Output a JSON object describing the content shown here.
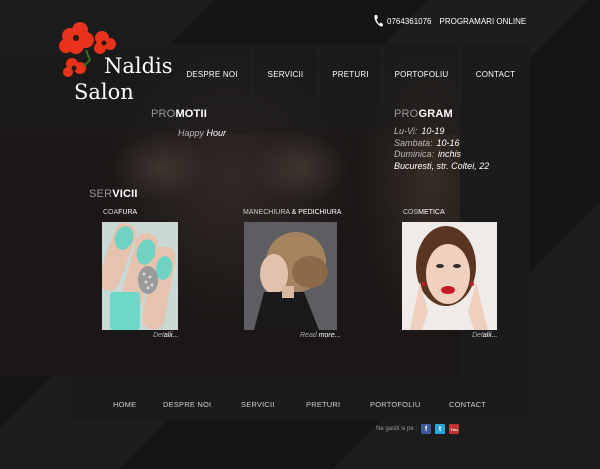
{
  "header": {
    "phone_icon": "phone-icon",
    "phone": "0764361076",
    "online_booking": "PROGRAMARI ONLINE"
  },
  "logo": {
    "line1": "Naldis",
    "line2": "Salon",
    "flower_color": "#e8321c"
  },
  "nav": {
    "items": [
      "DESPRE NOI",
      "SERVICII",
      "PRETURI",
      "PORTOFOLIU",
      "CONTACT"
    ]
  },
  "promo": {
    "title_a": "PRO",
    "title_b": "MOTII",
    "text_a": "Happy",
    "text_b": "Hour"
  },
  "program": {
    "title_a": "PRO",
    "title_b": "GRAM",
    "rows": [
      {
        "day": "Lu-Vi:",
        "value": "10-19"
      },
      {
        "day": "Sambata:",
        "value": "10-16"
      },
      {
        "day": "Duminica:",
        "value": "inchis"
      }
    ],
    "address": "Bucuresti, str. Coltei, 22"
  },
  "services": {
    "title_a": "SER",
    "title_b": "VICII",
    "cards": [
      {
        "title_a": "COA",
        "title_b": "FURA",
        "link_a": "Det",
        "link_b": "alii..."
      },
      {
        "title_a": "MANECHIURA",
        "title_b": " & PEDICHIURA",
        "link_a": "Read",
        "link_b": " more..."
      },
      {
        "title_a": "COS",
        "title_b": "METICA",
        "link_a": "Det",
        "link_b": "alii..."
      }
    ]
  },
  "footer": {
    "items": [
      "HOME",
      "DESPRE NOI",
      "SERVICII",
      "PRETURI",
      "PORTOFOLIU",
      "CONTACT"
    ],
    "social_label": "Ne gasiti si pe :",
    "social": [
      {
        "icon": "facebook-icon",
        "glyph": "f",
        "color": "#3b5998"
      },
      {
        "icon": "twitter-icon",
        "glyph": "t",
        "color": "#2aa3d8"
      },
      {
        "icon": "youtube-icon",
        "glyph": "You",
        "color": "#c4302b"
      }
    ]
  }
}
